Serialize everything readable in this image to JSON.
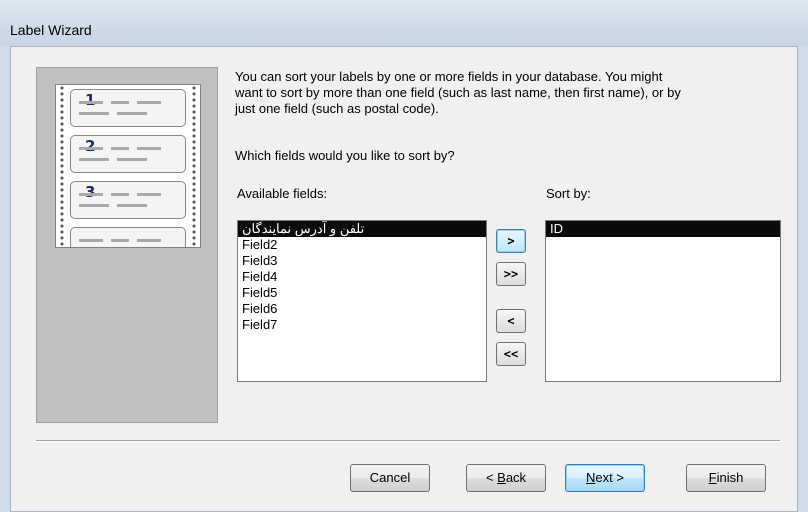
{
  "window": {
    "title": "Label Wizard"
  },
  "instructions": {
    "line1": "You can sort your labels by one or more fields in your database.  You might",
    "line2": "want to sort by more than one field (such as last name, then first name), or by",
    "line3": "just one field (such as postal code).",
    "question": "Which fields would you like to sort by?"
  },
  "illustration": {
    "label_numbers": [
      "1",
      "2",
      "3"
    ]
  },
  "available": {
    "label": "Available fields:",
    "items": [
      "تلفن و آدرس نمایندگان",
      "Field2",
      "Field3",
      "Field4",
      "Field5",
      "Field6",
      "Field7"
    ]
  },
  "sortby": {
    "label": "Sort by:",
    "items": [
      "ID"
    ]
  },
  "move_buttons": {
    "add_one": ">",
    "add_all": ">>",
    "remove_one": "<",
    "remove_all": "<<"
  },
  "footer": {
    "cancel": "Cancel",
    "back_prefix": "< ",
    "back_key": "B",
    "back_rest": "ack",
    "next_key": "N",
    "next_rest": "ext >",
    "finish_key": "F",
    "finish_rest": "inish"
  },
  "colors": {
    "selection": "#0b0b0b",
    "focus_border": "#3c7fb1"
  }
}
